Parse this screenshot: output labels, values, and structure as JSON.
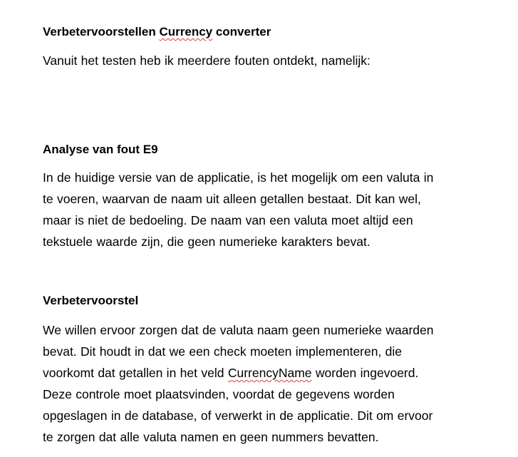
{
  "document": {
    "title_prefix": "Verbetervoorstellen ",
    "title_flagged": "Currency",
    "title_suffix": " converter",
    "intro": "Vanuit het testen heb ik meerdere fouten ontdekt, namelijk:",
    "section1": {
      "heading": "Analyse van fout E9",
      "lines": [
        "In de huidige versie van de applicatie, is het mogelijk om een valuta in",
        "te voeren, waarvan de naam uit alleen getallen bestaat. Dit kan wel,",
        "maar is niet de bedoeling. De naam van een valuta moet altijd een",
        "tekstuele waarde zijn, die geen numerieke karakters bevat."
      ]
    },
    "section2": {
      "heading": "Verbetervoorstel",
      "line1": "We willen ervoor zorgen dat de valuta naam geen numerieke waarden",
      "line2": "bevat. Dit houdt in dat we een check moeten implementeren, die",
      "line3_prefix": "voorkomt dat getallen in het veld ",
      "line3_flagged": "CurrencyName",
      "line3_suffix": " worden ingevoerd.",
      "line4": "Deze controle moet plaatsvinden, voordat de gegevens worden",
      "line5": "opgeslagen in de database, of verwerkt in de applicatie. Dit om ervoor",
      "line6": "te zorgen dat alle valuta namen en geen nummers bevatten."
    }
  }
}
